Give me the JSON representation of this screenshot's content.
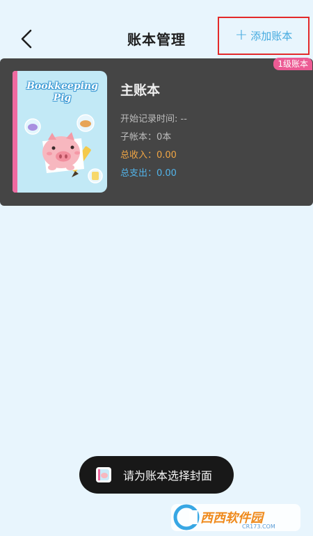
{
  "header": {
    "title": "账本管理",
    "add_label": "添加账本",
    "add_icon": "plus-icon",
    "back_icon": "back-chevron-icon"
  },
  "book": {
    "level_badge": "1级账本",
    "cover_title_line1": "Bookkeeping",
    "cover_title_line2": "Pig",
    "name": "主账本",
    "start_time": "开始记录时间: --",
    "sub_books": "子帐本：0本",
    "income": "总收入：0.00",
    "expense": "总支出：0.00"
  },
  "toast": {
    "text": "请为账本选择封面"
  },
  "watermark": {
    "brand": "西西软件园",
    "site": "CR173.COM"
  },
  "colors": {
    "background": "#e8f5fd",
    "accent": "#44aadf",
    "highlight_border": "#e32929",
    "badge": "#ec5b94",
    "income": "#f0a544",
    "expense": "#52b4ea"
  }
}
